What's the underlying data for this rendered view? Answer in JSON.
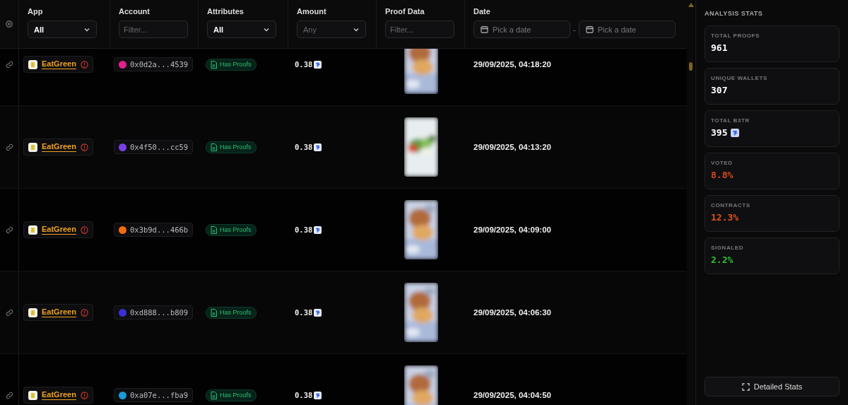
{
  "filters": [
    {
      "label": "App",
      "kind": "select",
      "value": "All"
    },
    {
      "label": "Account",
      "kind": "text",
      "placeholder": "Filter..."
    },
    {
      "label": "Attributes",
      "kind": "select",
      "value": "All"
    },
    {
      "label": "Amount",
      "kind": "select",
      "placeholder": "Any"
    },
    {
      "label": "Proof Data",
      "kind": "text",
      "placeholder": "Filter..."
    },
    {
      "label": "Date",
      "kind": "daterange",
      "from_placeholder": "Pick a date",
      "separator": "-",
      "to_placeholder": "Pick a date"
    }
  ],
  "rows": [
    {
      "app": "EatGreen",
      "account": "0x0d2a...4539",
      "color": "#e0218a",
      "attribute": "Has Proofs",
      "amount": "0.38",
      "date": "29/09/2025, 04:18:20"
    },
    {
      "app": "EatGreen",
      "account": "0x4f50...cc59",
      "color": "#7b3fe4",
      "attribute": "Has Proofs",
      "amount": "0.38",
      "date": "29/09/2025, 04:13:20"
    },
    {
      "app": "EatGreen",
      "account": "0x3b9d...466b",
      "color": "#f26b0f",
      "attribute": "Has Proofs",
      "amount": "0.38",
      "date": "29/09/2025, 04:09:00"
    },
    {
      "app": "EatGreen",
      "account": "0xd888...b809",
      "color": "#3a2fd6",
      "attribute": "Has Proofs",
      "amount": "0.38",
      "date": "29/09/2025, 04:06:30"
    },
    {
      "app": "EatGreen",
      "account": "0xa07e...fba9",
      "color": "#1a9ad6",
      "attribute": "Has Proofs",
      "amount": "0.38",
      "date": "29/09/2025, 04:04:50"
    }
  ],
  "stats": {
    "title": "ANALYSIS STATS",
    "items": [
      {
        "label": "TOTAL PROOFS",
        "value": "961",
        "color": "#ffffff",
        "token": false
      },
      {
        "label": "UNIQUE WALLETS",
        "value": "307",
        "color": "#ffffff",
        "token": false
      },
      {
        "label": "TOTAL B3TR",
        "value": "395",
        "color": "#ffffff",
        "token": true
      },
      {
        "label": "VOTED",
        "value": "8.8%",
        "color": "#d8461c",
        "token": false
      },
      {
        "label": "CONTRACTS",
        "value": "12.3%",
        "color": "#e0521a",
        "token": false
      },
      {
        "label": "SIGNALED",
        "value": "2.2%",
        "color": "#2fbf2f",
        "token": false
      }
    ],
    "button": "Detailed Stats"
  }
}
